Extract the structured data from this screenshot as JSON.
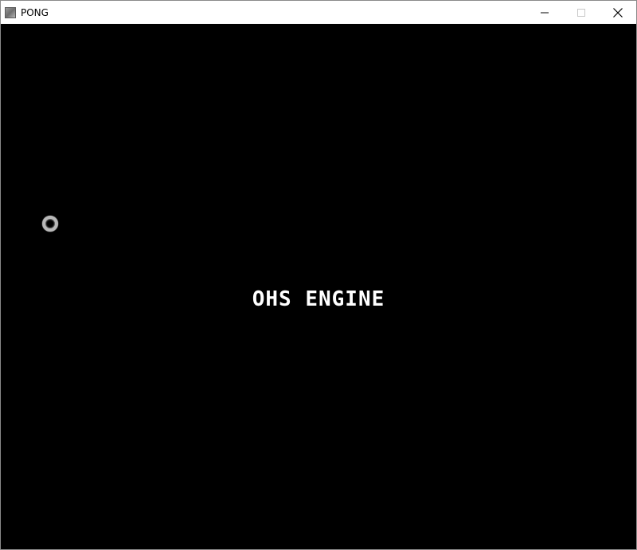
{
  "window": {
    "title": "PONG",
    "icon": "app-window-icon"
  },
  "controls": {
    "minimize_icon": "minimize-icon",
    "maximize_icon": "maximize-icon",
    "close_icon": "close-icon"
  },
  "game": {
    "splash_text": "OHS ENGINE",
    "background_color": "#000000",
    "text_color": "#ffffff",
    "ball_color": "#b8b8b8"
  }
}
